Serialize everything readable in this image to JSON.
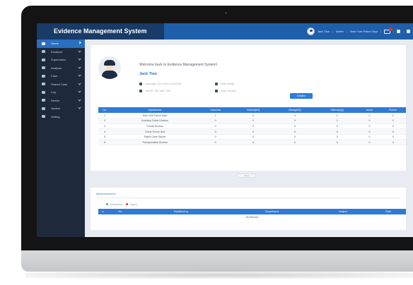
{
  "app": {
    "title": "Evidence Management System"
  },
  "topbar": {
    "user": "Jack Tian",
    "items": [
      "Admin",
      "New York Police Dept"
    ]
  },
  "sidebar": {
    "items": [
      {
        "label": "Home",
        "active": true
      },
      {
        "label": "Evidence"
      },
      {
        "label": "Supervision"
      },
      {
        "label": "Analysis"
      },
      {
        "label": "Case"
      },
      {
        "label": "Shared Case"
      },
      {
        "label": "Log"
      },
      {
        "label": "Device"
      },
      {
        "label": "System"
      },
      {
        "label": "Setting"
      }
    ]
  },
  "welcome": {
    "greeting": "Welcome back to Evidence Management System!",
    "user_name": "Jack Tian",
    "last_login": "Last login: 2017-09-14 10:32:56",
    "last_ip": "Last IP: 192.168.7.120",
    "role": "Role: Admin",
    "dept": "Dept: Central",
    "details_label": "Details"
  },
  "stats_table": {
    "headers": [
      "No.",
      "Department",
      "Cameras",
      "Videos(hrs)",
      "Storage(G)",
      "Videos(Qty)",
      "Audio",
      "Picture"
    ],
    "rows": [
      [
        "1",
        "New York Police Dept",
        "1",
        "0",
        "0",
        "0",
        "0",
        "0"
      ],
      [
        "2",
        "Auxiliary Police Division",
        "0",
        "0",
        "0",
        "0",
        "0",
        "0"
      ],
      [
        "3",
        "Transit Bureau",
        "0",
        "0",
        "0",
        "0",
        "0",
        "0"
      ],
      [
        "4",
        "Crime Scene Unit",
        "0",
        "0",
        "0",
        "0",
        "0",
        "0"
      ],
      [
        "5",
        "Rapid Case Squad",
        "0",
        "0",
        "0",
        "0",
        "0",
        "0"
      ],
      [
        "6",
        "Transportation Bureau",
        "0",
        "0",
        "0",
        "0",
        "0",
        "0"
      ]
    ]
  },
  "more_label": "More",
  "alarm": {
    "title": "Announcement",
    "legend": [
      {
        "label": "Unimportant",
        "color": "#52b043"
      },
      {
        "label": "Urgent",
        "color": "#e0322b"
      }
    ],
    "headers": [
      "#",
      "No.",
      "Published by",
      "Department",
      "Subject",
      "Date"
    ],
    "empty": "No Record"
  },
  "colors": {
    "topbar": "#1f5faa",
    "brand": "#183b67",
    "sidebar": "#1e2a3c",
    "accent": "#2f7ad6"
  }
}
